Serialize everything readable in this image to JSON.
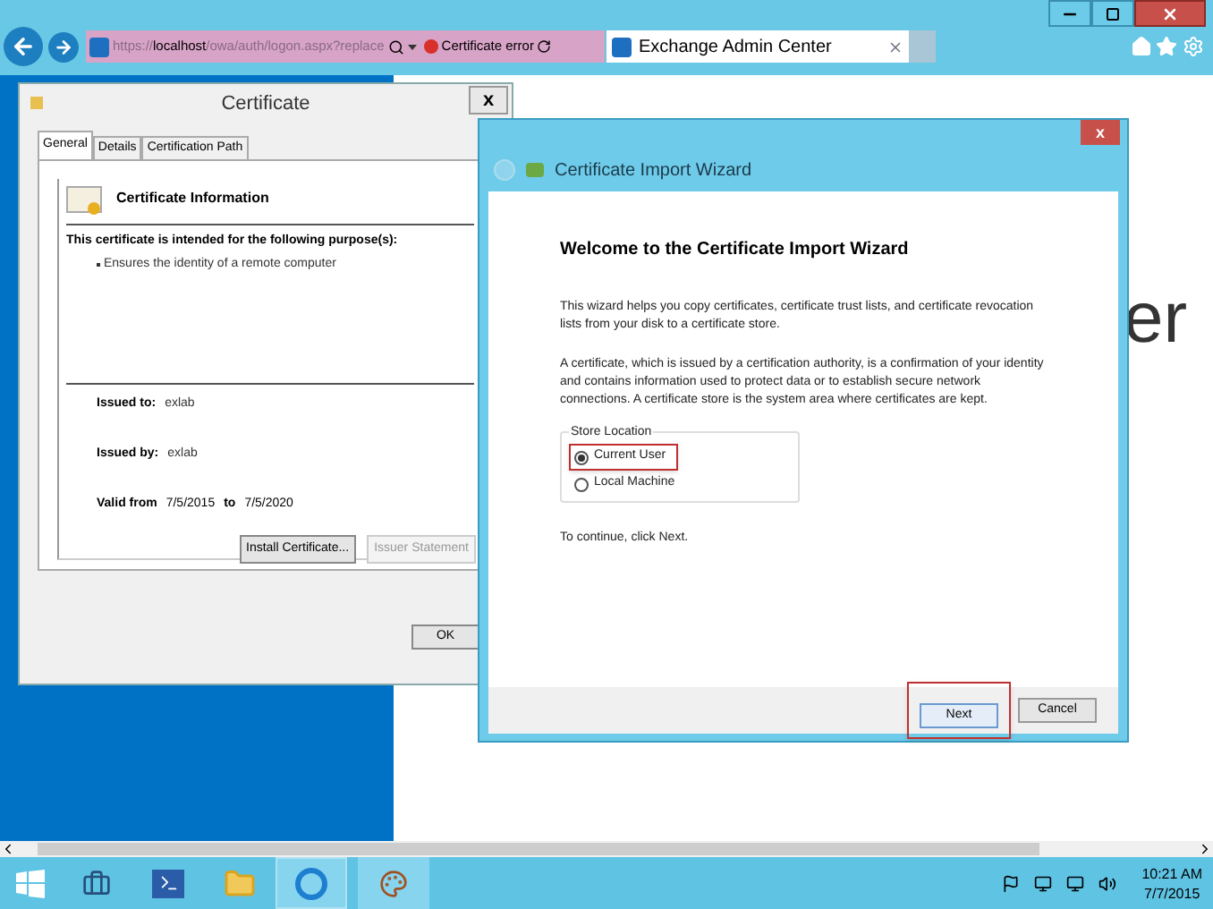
{
  "browser": {
    "url_prefix": "https://",
    "url_host": "localhost",
    "url_path": "/owa/auth/logon.aspx?replace",
    "cert_error": "Certificate error",
    "tabs": [
      {
        "label": "Exchange Admin Center",
        "selected": true
      }
    ],
    "page_heading_fragment": "er"
  },
  "certificate_dialog": {
    "title": "Certificate",
    "close": "x",
    "tabs": [
      {
        "label": "General",
        "selected": true
      },
      {
        "label": "Details",
        "selected": false
      },
      {
        "label": "Certification Path",
        "selected": false
      }
    ],
    "info_title": "Certificate Information",
    "purpose_heading": "This certificate is intended for the following purpose(s):",
    "purposes": [
      "Ensures the identity of a remote computer"
    ],
    "fields": [
      {
        "label": "Issued to:",
        "value": "exlab"
      },
      {
        "label": "Issued by:",
        "value": "exlab"
      }
    ],
    "valid_label": "Valid from",
    "valid_from": "7/5/2015",
    "valid_to_label": "to",
    "valid_to": "7/5/2020",
    "buttons": [
      {
        "label": "Install Certificate...",
        "disabled": false
      },
      {
        "label": "Issuer Statement",
        "disabled": true
      }
    ],
    "ok": "OK"
  },
  "wizard": {
    "title": "Certificate Import Wizard",
    "close": "x",
    "heading": "Welcome to the Certificate Import Wizard",
    "paragraphs": [
      "This wizard helps you copy certificates, certificate trust lists, and certificate revocation lists from your disk to a certificate store.",
      "A certificate, which is issued by a certification authority, is a confirmation of your identity and contains information used to protect data or to establish secure network connections. A certificate store is the system area where certificates are kept."
    ],
    "store_location": {
      "legend": "Store Location",
      "options": [
        {
          "label": "Current User",
          "selected": true
        },
        {
          "label": "Local Machine",
          "selected": false
        }
      ]
    },
    "hint": "To continue, click Next.",
    "buttons": [
      {
        "label": "Next",
        "kind": "primary"
      },
      {
        "label": "Cancel",
        "kind": "secondary"
      }
    ]
  },
  "taskbar": {
    "time": "10:21 AM",
    "date": "7/7/2015"
  }
}
